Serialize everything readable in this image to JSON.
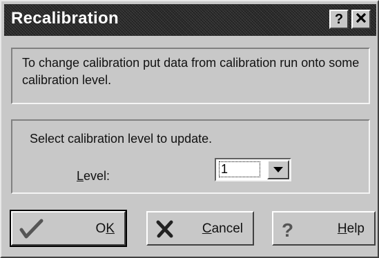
{
  "window": {
    "title": "Recalibration",
    "help_glyph": "?",
    "close_glyph": "✕"
  },
  "info": {
    "text": "To change calibration put data from calibration run onto some calibration level."
  },
  "level_group": {
    "prompt": "Select calibration level to update.",
    "level_label_mnemonic": "L",
    "level_label_rest": "evel:",
    "level_value": "1"
  },
  "buttons": {
    "ok": {
      "pre": "O",
      "mnemonic": "K",
      "post": "",
      "icon": "checkmark-icon"
    },
    "cancel": {
      "pre": "",
      "mnemonic": "C",
      "post": "ancel",
      "icon": "x-mark-icon"
    },
    "help": {
      "pre": "",
      "mnemonic": "H",
      "post": "elp",
      "icon": "question-icon"
    }
  }
}
